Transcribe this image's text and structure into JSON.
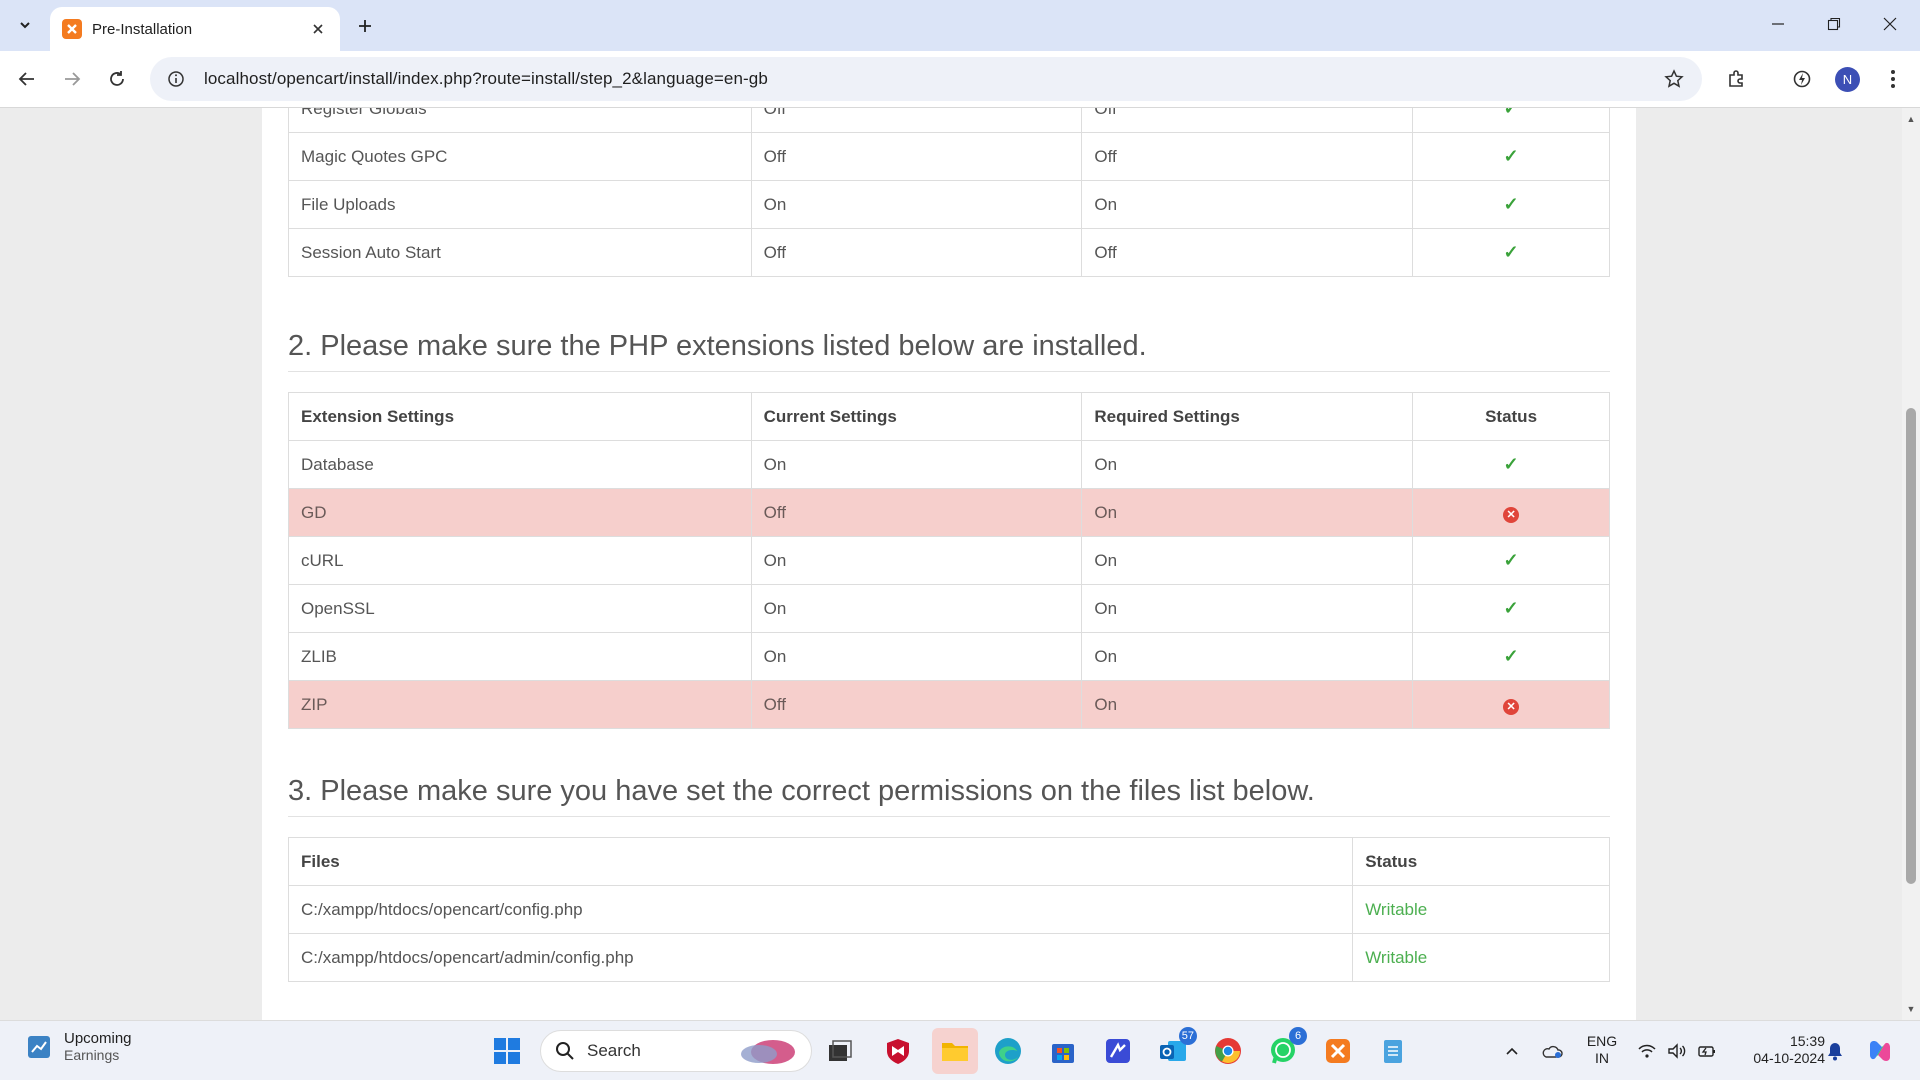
{
  "browser": {
    "tab_title": "Pre-Installation",
    "url": "localhost/opencart/install/index.php?route=install/step_2&language=en-gb",
    "profile_initial": "N"
  },
  "settings_table": {
    "rows": [
      {
        "name": "Register Globals",
        "current": "Off",
        "required": "Off",
        "status": "ok"
      },
      {
        "name": "Magic Quotes GPC",
        "current": "Off",
        "required": "Off",
        "status": "ok"
      },
      {
        "name": "File Uploads",
        "current": "On",
        "required": "On",
        "status": "ok"
      },
      {
        "name": "Session Auto Start",
        "current": "Off",
        "required": "Off",
        "status": "ok"
      }
    ]
  },
  "section2": {
    "heading": "2. Please make sure the PHP extensions listed below are installed.",
    "headers": {
      "extension": "Extension Settings",
      "current": "Current Settings",
      "required": "Required Settings",
      "status": "Status"
    },
    "rows": [
      {
        "name": "Database",
        "current": "On",
        "required": "On",
        "status": "ok"
      },
      {
        "name": "GD",
        "current": "Off",
        "required": "On",
        "status": "error"
      },
      {
        "name": "cURL",
        "current": "On",
        "required": "On",
        "status": "ok"
      },
      {
        "name": "OpenSSL",
        "current": "On",
        "required": "On",
        "status": "ok"
      },
      {
        "name": "ZLIB",
        "current": "On",
        "required": "On",
        "status": "ok"
      },
      {
        "name": "ZIP",
        "current": "Off",
        "required": "On",
        "status": "error"
      }
    ]
  },
  "section3": {
    "heading": "3. Please make sure you have set the correct permissions on the files list below.",
    "headers": {
      "files": "Files",
      "status": "Status"
    },
    "rows": [
      {
        "file": "C:/xampp/htdocs/opencart/config.php",
        "status": "Writable"
      },
      {
        "file": "C:/xampp/htdocs/opencart/admin/config.php",
        "status": "Writable"
      }
    ]
  },
  "taskbar": {
    "weather_title": "Upcoming",
    "weather_sub": "Earnings",
    "search_label": "Search",
    "outlook_badge": "57",
    "whatsapp_badge": "6",
    "lang_line1": "ENG",
    "lang_line2": "IN",
    "time": "15:39",
    "date": "04-10-2024"
  },
  "colors": {
    "success": "#3aa23a",
    "danger_row": "#f6cfcc",
    "error_icon": "#e0453a",
    "writable": "#4caf50"
  }
}
